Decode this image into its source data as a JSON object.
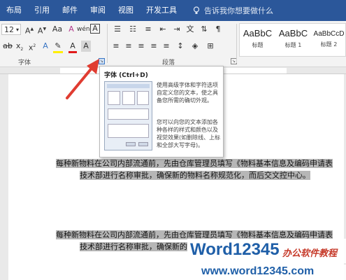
{
  "ribbon_tabs": [
    {
      "label": "布局"
    },
    {
      "label": "引用"
    },
    {
      "label": "邮件"
    },
    {
      "label": "审阅"
    },
    {
      "label": "视图"
    },
    {
      "label": "开发工具"
    }
  ],
  "tell_me": {
    "label": "告诉我你想要做什么"
  },
  "font_group": {
    "label": "字体",
    "font_size": "12"
  },
  "paragraph_group": {
    "label": "段落"
  },
  "styles": [
    {
      "sample": "AaBbC",
      "name": "标题"
    },
    {
      "sample": "AaBbC",
      "name": "标题 1"
    },
    {
      "sample": "AaBbCcD",
      "name": "标题 2"
    }
  ],
  "tooltip": {
    "title": "字体 (Ctrl+D)",
    "description": "使用高级字体和字符选项自定义您的文本，使之具备您所需的确切外观。",
    "detail": "您可以向您的文本添加各种各样的样式和颜色以及视觉效果(如删除线、上标和全部大写字母)。"
  },
  "document": {
    "paragraph1_line1": "每种新物料在公司内部流通前，先由仓库管理员填写《物料基本信息及编码申请表",
    "paragraph1_line2": "技术部进行名称审批，确保新的物料名称规范化，而后交文控中心。",
    "paragraph2_line1": "每种新物料在公司内部流通前，先由仓库管理员填写《物料基本信息及编码申请表",
    "paragraph2_line2": "技术部进行名称审批，确保新的"
  },
  "watermark": {
    "brand": "Word12345",
    "tagline": "办公软件教程",
    "url": "www.word12345.com"
  },
  "colors": {
    "ribbon_blue": "#2b579a",
    "highlight_gray": "#b6b6b6",
    "arrow_red": "#e03c31"
  }
}
